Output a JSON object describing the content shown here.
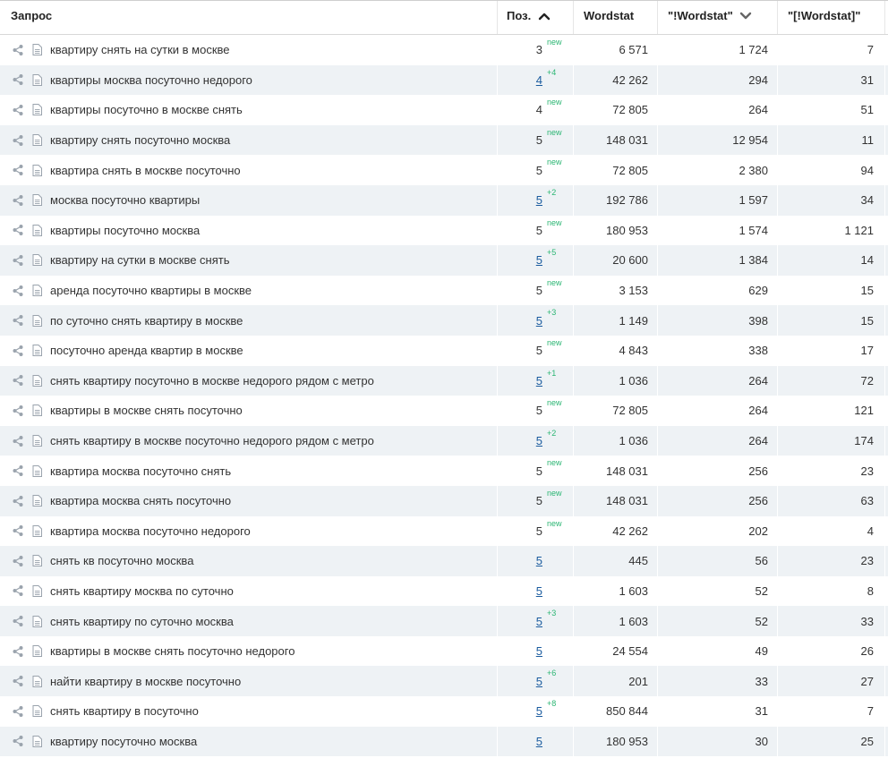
{
  "table": {
    "headers": {
      "query": "Запрос",
      "pos": "Поз.",
      "wordstat": "Wordstat",
      "wordstat_excl": "\"!Wordstat\"",
      "wordstat_exact": "\"[!Wordstat]\""
    },
    "sort": {
      "pos": "ascending",
      "wordstat_excl": "descending"
    },
    "colors": {
      "link": "#1a5b9e",
      "delta": "#2bb673",
      "row_alt": "#eef2f5"
    },
    "rows": [
      {
        "query": "квартиру снять на сутки в москве",
        "pos": "3",
        "pos_link": false,
        "delta": "new",
        "wordstat": "6 571",
        "ws2": "1 724",
        "ws3": "7"
      },
      {
        "query": "квартиры москва посуточно недорого",
        "pos": "4",
        "pos_link": true,
        "delta": "+4",
        "wordstat": "42 262",
        "ws2": "294",
        "ws3": "31"
      },
      {
        "query": "квартиры посуточно в москве снять",
        "pos": "4",
        "pos_link": false,
        "delta": "new",
        "wordstat": "72 805",
        "ws2": "264",
        "ws3": "51"
      },
      {
        "query": "квартиру снять посуточно москва",
        "pos": "5",
        "pos_link": false,
        "delta": "new",
        "wordstat": "148 031",
        "ws2": "12 954",
        "ws3": "11"
      },
      {
        "query": "квартира снять в москве посуточно",
        "pos": "5",
        "pos_link": false,
        "delta": "new",
        "wordstat": "72 805",
        "ws2": "2 380",
        "ws3": "94"
      },
      {
        "query": "москва посуточно квартиры",
        "pos": "5",
        "pos_link": true,
        "delta": "+2",
        "wordstat": "192 786",
        "ws2": "1 597",
        "ws3": "34"
      },
      {
        "query": "квартиры посуточно москва",
        "pos": "5",
        "pos_link": false,
        "delta": "new",
        "wordstat": "180 953",
        "ws2": "1 574",
        "ws3": "1 121"
      },
      {
        "query": "квартиру на сутки в москве снять",
        "pos": "5",
        "pos_link": true,
        "delta": "+5",
        "wordstat": "20 600",
        "ws2": "1 384",
        "ws3": "14"
      },
      {
        "query": "аренда посуточно квартиры в москве",
        "pos": "5",
        "pos_link": false,
        "delta": "new",
        "wordstat": "3 153",
        "ws2": "629",
        "ws3": "15"
      },
      {
        "query": "по суточно снять квартиру в москве",
        "pos": "5",
        "pos_link": true,
        "delta": "+3",
        "wordstat": "1 149",
        "ws2": "398",
        "ws3": "15"
      },
      {
        "query": "посуточно аренда квартир в москве",
        "pos": "5",
        "pos_link": false,
        "delta": "new",
        "wordstat": "4 843",
        "ws2": "338",
        "ws3": "17"
      },
      {
        "query": "снять квартиру посуточно в москве недорого рядом с метро",
        "pos": "5",
        "pos_link": true,
        "delta": "+1",
        "wordstat": "1 036",
        "ws2": "264",
        "ws3": "72"
      },
      {
        "query": "квартиры в москве снять посуточно",
        "pos": "5",
        "pos_link": false,
        "delta": "new",
        "wordstat": "72 805",
        "ws2": "264",
        "ws3": "121"
      },
      {
        "query": "снять квартиру в москве посуточно недорого рядом с метро",
        "pos": "5",
        "pos_link": true,
        "delta": "+2",
        "wordstat": "1 036",
        "ws2": "264",
        "ws3": "174"
      },
      {
        "query": "квартира москва посуточно снять",
        "pos": "5",
        "pos_link": false,
        "delta": "new",
        "wordstat": "148 031",
        "ws2": "256",
        "ws3": "23"
      },
      {
        "query": "квартира москва снять посуточно",
        "pos": "5",
        "pos_link": false,
        "delta": "new",
        "wordstat": "148 031",
        "ws2": "256",
        "ws3": "63"
      },
      {
        "query": "квартира москва посуточно недорого",
        "pos": "5",
        "pos_link": false,
        "delta": "new",
        "wordstat": "42 262",
        "ws2": "202",
        "ws3": "4"
      },
      {
        "query": "снять кв посуточно москва",
        "pos": "5",
        "pos_link": true,
        "delta": "",
        "wordstat": "445",
        "ws2": "56",
        "ws3": "23"
      },
      {
        "query": "снять квартиру москва по суточно",
        "pos": "5",
        "pos_link": true,
        "delta": "",
        "wordstat": "1 603",
        "ws2": "52",
        "ws3": "8"
      },
      {
        "query": "снять квартиру по суточно москва",
        "pos": "5",
        "pos_link": true,
        "delta": "+3",
        "wordstat": "1 603",
        "ws2": "52",
        "ws3": "33"
      },
      {
        "query": "квартиры в москве снять посуточно недорого",
        "pos": "5",
        "pos_link": true,
        "delta": "",
        "wordstat": "24 554",
        "ws2": "49",
        "ws3": "26"
      },
      {
        "query": "найти квартиру в москве посуточно",
        "pos": "5",
        "pos_link": true,
        "delta": "+6",
        "wordstat": "201",
        "ws2": "33",
        "ws3": "27"
      },
      {
        "query": "снять квартиру в посуточно",
        "pos": "5",
        "pos_link": true,
        "delta": "+8",
        "wordstat": "850 844",
        "ws2": "31",
        "ws3": "7"
      },
      {
        "query": "квартиру посуточно москва",
        "pos": "5",
        "pos_link": true,
        "delta": "",
        "wordstat": "180 953",
        "ws2": "30",
        "ws3": "25"
      }
    ]
  }
}
